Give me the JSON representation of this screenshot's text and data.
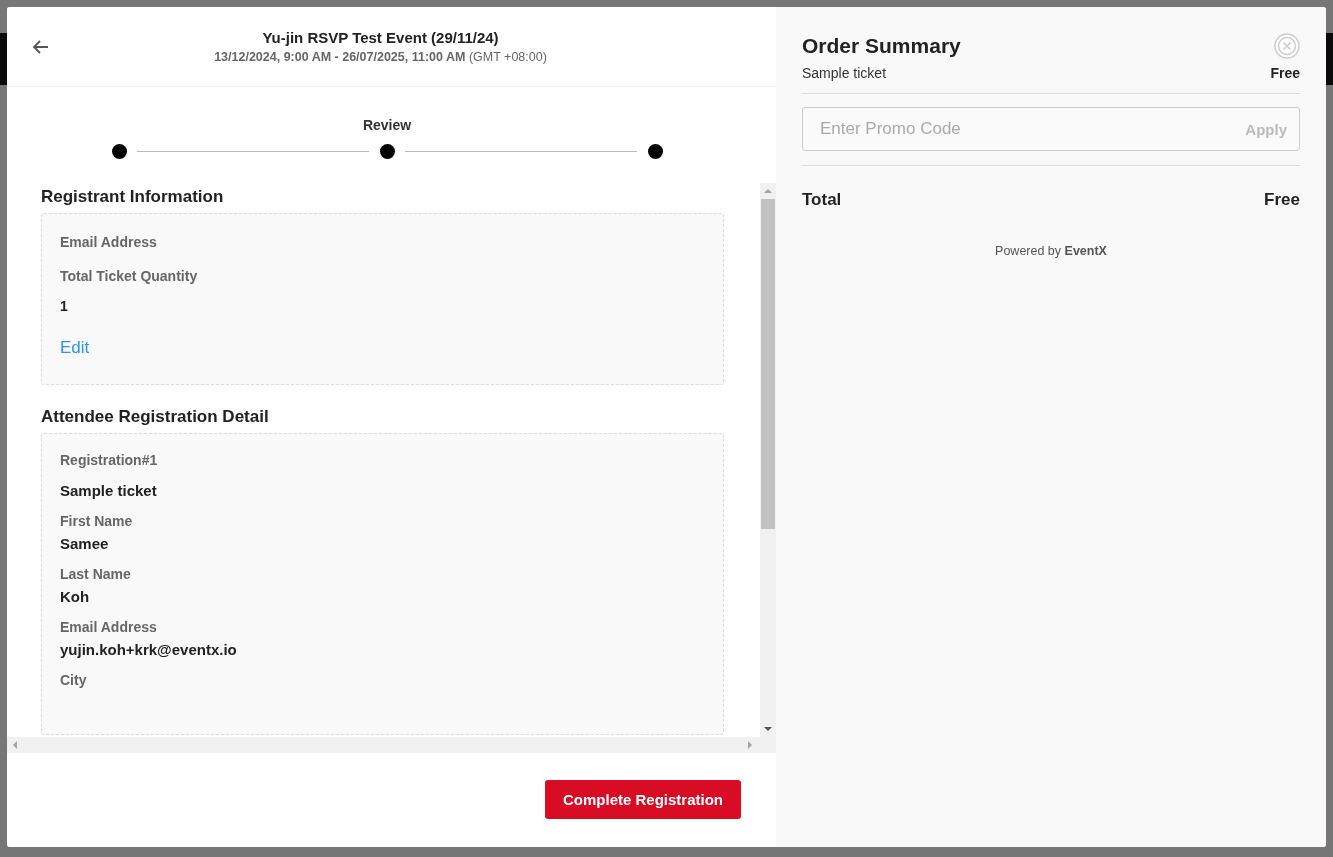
{
  "header": {
    "title": "Yu-jin RSVP Test Event (29/11/24)",
    "dates": "13/12/2024, 9:00 AM - 26/07/2025, 11:00 AM",
    "timezone": "(GMT +08:00)"
  },
  "stepper": {
    "label": "Review"
  },
  "registrant": {
    "heading": "Registrant Information",
    "fields": [
      {
        "label": "Email Address"
      },
      {
        "label": "Total Ticket Quantity",
        "value": "1"
      }
    ],
    "edit_link": "Edit"
  },
  "attendee": {
    "heading": "Attendee Registration Detail",
    "registration": "Registration#1",
    "ticket": "Sample ticket",
    "fields": [
      {
        "label": "First Name",
        "value": "Samee"
      },
      {
        "label": "Last Name",
        "value": "Koh"
      },
      {
        "label": "Email Address",
        "value": "yujin.koh+krk@eventx.io"
      },
      {
        "label": "City"
      }
    ]
  },
  "complete_button": "Complete Registration",
  "order_summary": {
    "title": "Order Summary",
    "items": [
      {
        "name": "Sample ticket",
        "price": "Free"
      }
    ],
    "promo": {
      "placeholder": "Enter Promo Code",
      "apply": "Apply"
    },
    "total_label": "Total",
    "total": "Free",
    "powered_prefix": "Powered by",
    "powered_brand": "EventX"
  }
}
